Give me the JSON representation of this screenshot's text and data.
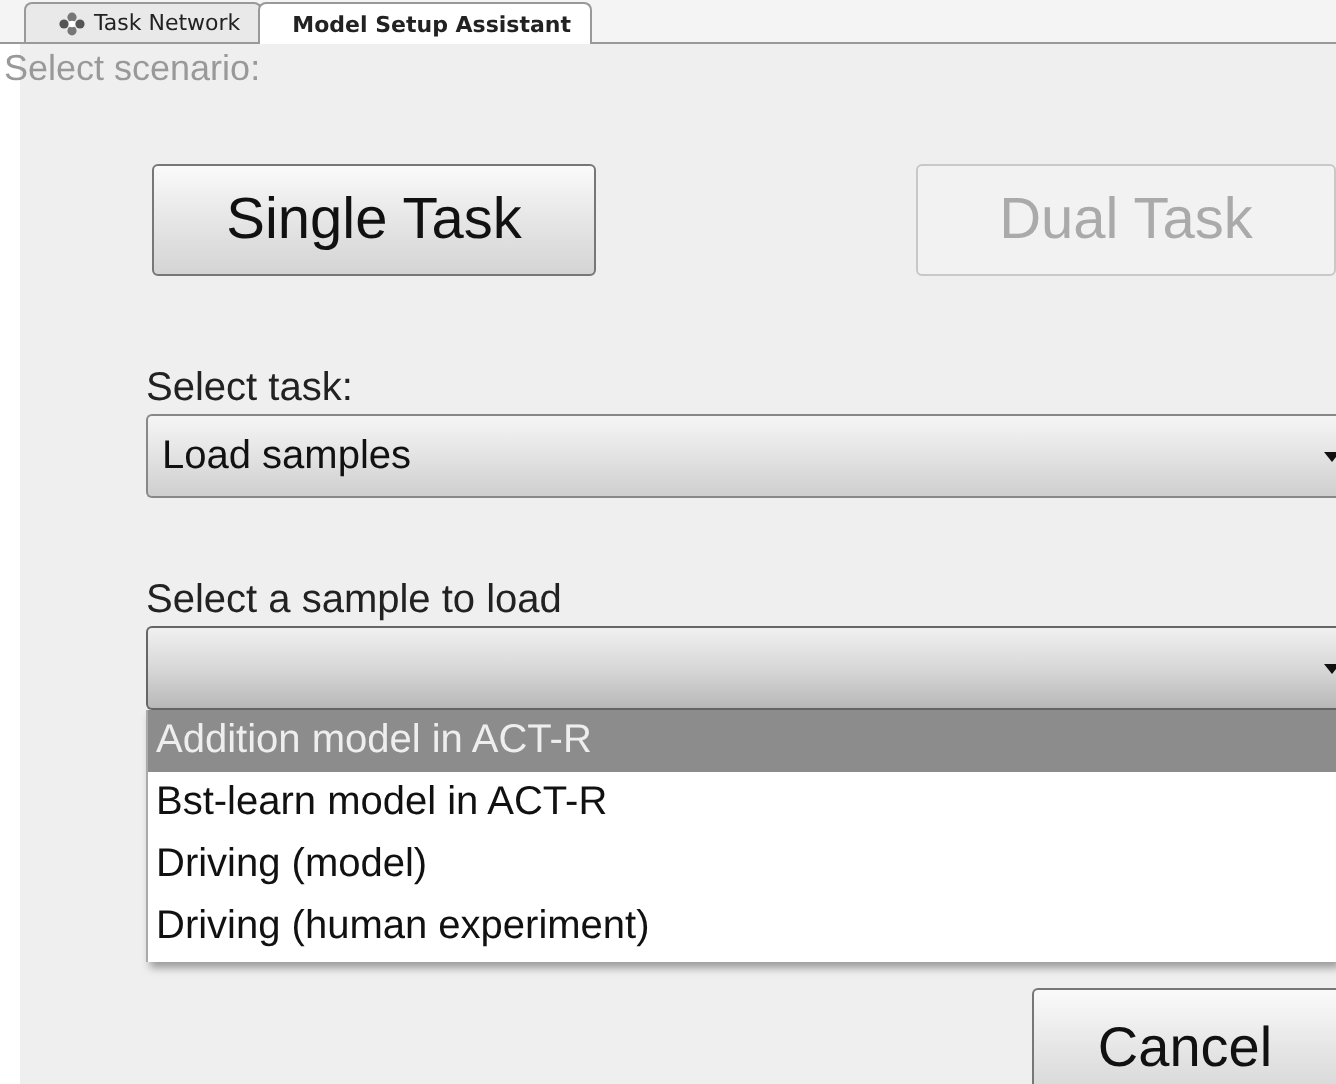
{
  "tabs": [
    {
      "label": "Task Network",
      "selected": false,
      "icon": true
    },
    {
      "label": "Model Setup Assistant",
      "selected": true,
      "icon": false
    }
  ],
  "scenario": {
    "label": "Select scenario:",
    "buttons": [
      {
        "label": "Single Task",
        "disabled": false
      },
      {
        "label": "Dual Task",
        "disabled": true
      }
    ]
  },
  "task": {
    "label": "Select task:",
    "value": "Load samples"
  },
  "sample": {
    "label": "Select a sample to load",
    "expanded": true,
    "options": [
      {
        "label": "Addition model in ACT-R",
        "selected": true
      },
      {
        "label": "Bst-learn model in ACT-R",
        "selected": false
      },
      {
        "label": "Driving (model)",
        "selected": false
      },
      {
        "label": "Driving (human experiment)",
        "selected": false
      }
    ]
  },
  "buttons": [
    {
      "label": "Cancel"
    }
  ]
}
